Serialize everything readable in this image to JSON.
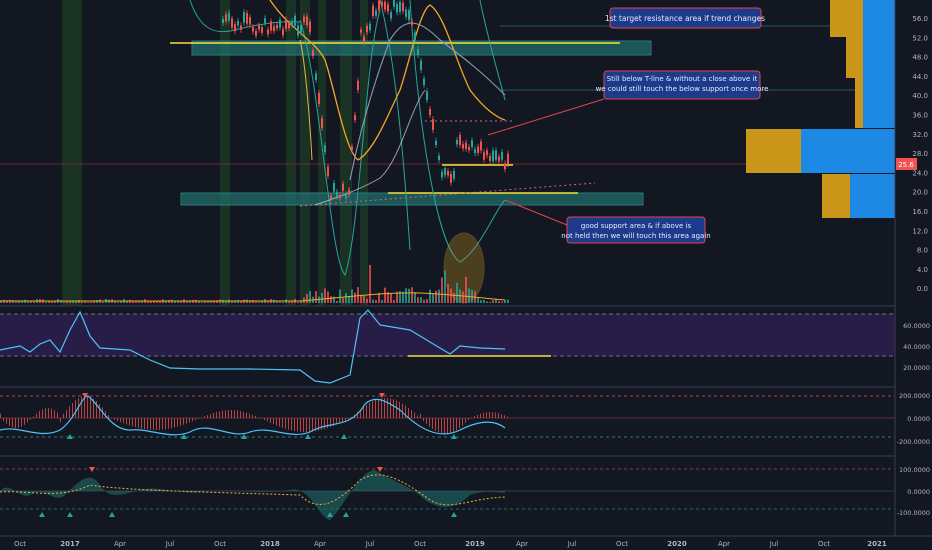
{
  "chart_data": {
    "type": "candlestick",
    "price_axis": {
      "ticks": [
        "56.0",
        "52.0",
        "48.0",
        "44.0",
        "40.0",
        "36.0",
        "32.0",
        "28.0",
        "24.0",
        "20.0",
        "16.0",
        "12.0",
        "8.0",
        "4.0",
        "0.0"
      ],
      "current_price_label": "25.6"
    },
    "time_axis": {
      "labels": [
        "Oct",
        "2017",
        "Apr",
        "Jul",
        "Oct",
        "2018",
        "Apr",
        "Jul",
        "Oct",
        "2019",
        "Apr",
        "Jul",
        "Oct",
        "2020",
        "Apr",
        "Jul",
        "Oct",
        "2021"
      ]
    },
    "annotations": [
      "1st target resistance area if trend changes",
      "Still below T-line & without a close above it we could still touch the below support once more",
      "good support area & if above is not held then we will touch this area again"
    ],
    "oscillator_1": {
      "ticks": [
        "60.0000",
        "40.0000",
        "20.0000"
      ]
    },
    "oscillator_2": {
      "ticks": [
        "200.0000",
        "0.0000",
        "-200.0000"
      ]
    },
    "oscillator_3": {
      "ticks": [
        "100.0000",
        "0.0000",
        "-100.0000"
      ]
    },
    "colors": {
      "background": "#131722",
      "bull": "#26a69a",
      "bear": "#ef5350",
      "zone": "#1f6b68",
      "yellow": "#f5e23b",
      "callout_bg": "#1e3a8a",
      "callout_border": "#e0454e",
      "rsi_line": "#4fc3f7",
      "rsi_band": "#2a1e4a",
      "vp_gold": "#c9961a",
      "vp_blue": "#1e88e5"
    }
  }
}
